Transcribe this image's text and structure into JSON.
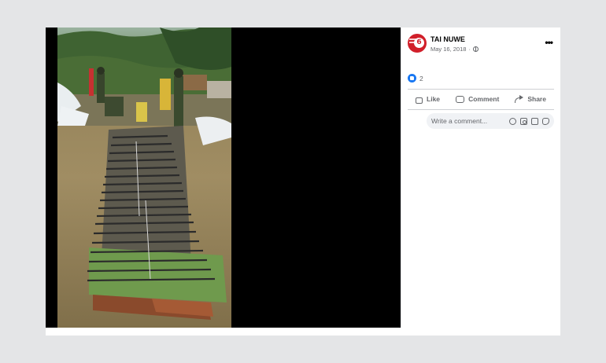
{
  "post": {
    "page_name": "TAI NUWE",
    "date": "May 16, 2018",
    "more_label": "•••",
    "reaction_count": "2"
  },
  "actions": {
    "like": "Like",
    "comment": "Comment",
    "share": "Share"
  },
  "comment_box": {
    "placeholder": "Write a comment..."
  },
  "avatar": {
    "badge": "6"
  },
  "colors": {
    "accent": "#1877f2",
    "avatar_bg": "#d11f2a",
    "viewer_bg": "#000000"
  },
  "icons": [
    "globe-icon",
    "more-icon",
    "like-reaction-icon",
    "like-icon",
    "comment-icon",
    "share-icon",
    "emoji-icon",
    "camera-icon",
    "gif-icon",
    "sticker-icon"
  ]
}
